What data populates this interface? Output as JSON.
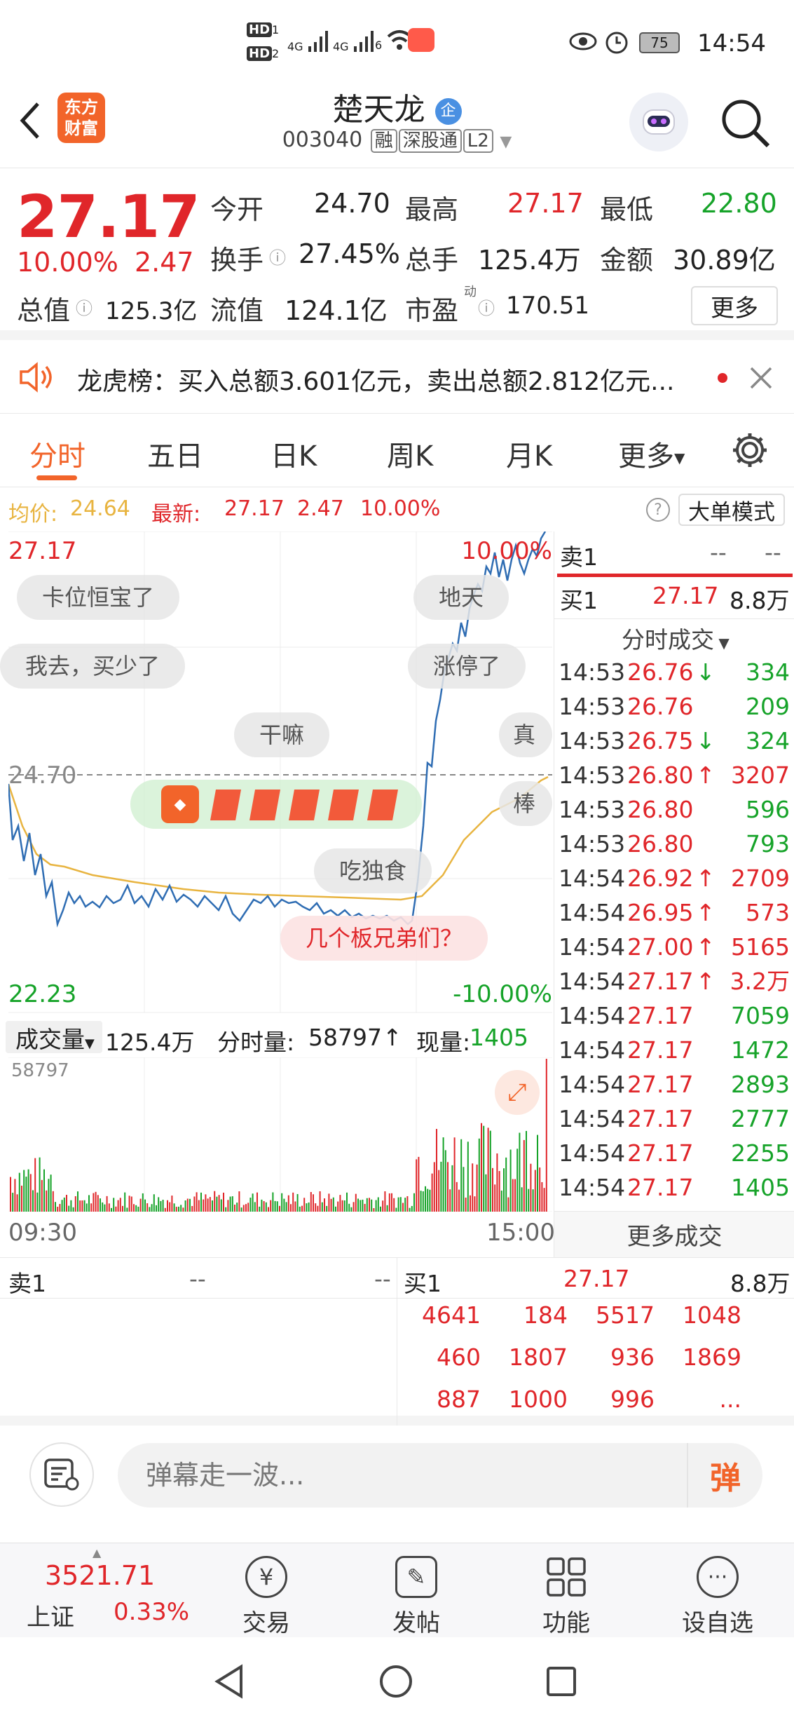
{
  "status_bar": {
    "hd1": "HD",
    "hd1_sub": "1",
    "hd2": "HD",
    "hd2_sub": "2",
    "net1": "4G",
    "net2": "4G",
    "wifi_sub": "6",
    "battery": "75",
    "time": "14:54"
  },
  "header": {
    "logo_line1": "东方",
    "logo_line2": "财富",
    "stock_name": "楚天龙",
    "badge": "企",
    "stock_code": "003040",
    "tags": [
      "融",
      "深股通",
      "L2"
    ]
  },
  "quote": {
    "price": "27.17",
    "change_pct": "10.00%",
    "change_amt": "2.47",
    "open_label": "今开",
    "open": "24.70",
    "high_label": "最高",
    "high": "27.17",
    "low_label": "最低",
    "low": "22.80",
    "turnover_label": "换手",
    "turnover": "27.45%",
    "volume_label": "总手",
    "volume": "125.4万",
    "amount_label": "金额",
    "amount": "30.89亿",
    "mktcap_label": "总值",
    "mktcap": "125.3亿",
    "float_label": "流值",
    "float": "124.1亿",
    "pe_label": "市盈",
    "pe_sup": "动",
    "pe": "170.51",
    "more_button": "更多"
  },
  "notice": {
    "text": "龙虎榜：买入总额3.601亿元，卖出总额2.812亿元..."
  },
  "tabs": {
    "items": [
      "分时",
      "五日",
      "日K",
      "周K",
      "月K",
      "更多"
    ]
  },
  "infoline": {
    "avg_label": "均价:",
    "avg": "24.64",
    "latest_label": "最新:",
    "latest": "27.17",
    "latest_chg": "2.47",
    "latest_pct": "10.00%",
    "mode_button": "大单模式"
  },
  "chart_labels": {
    "top_price": "27.17",
    "top_pct": "10.00%",
    "mid_price": "24.70",
    "bottom_price": "22.23",
    "bottom_pct": "-10.00%"
  },
  "danmaku": [
    "卡位恒宝了",
    "地天",
    "我去，买少了",
    "涨停了",
    "干嘛",
    "真",
    "棒",
    "吃独食",
    "几个板兄弟们？"
  ],
  "volume": {
    "label": "成交量",
    "total": "125.4万",
    "minute_label": "分时量:",
    "minute": "58797",
    "current_label": "现量:",
    "current": "1405",
    "max_label": "58797",
    "time_start": "09:30",
    "time_end": "15:00"
  },
  "panel": {
    "sell1_label": "卖1",
    "sell1_price": "--",
    "sell1_vol": "--",
    "buy1_label": "买1",
    "buy1_price": "27.17",
    "buy1_vol": "8.8万",
    "ticks_title": "分时成交",
    "ticks": [
      {
        "t": "14:53",
        "p": "26.76",
        "arrow": "↓",
        "v": "334",
        "pc": "red",
        "vc": "green"
      },
      {
        "t": "14:53",
        "p": "26.76",
        "arrow": "",
        "v": "209",
        "pc": "red",
        "vc": "green"
      },
      {
        "t": "14:53",
        "p": "26.75",
        "arrow": "↓",
        "v": "324",
        "pc": "red",
        "vc": "green"
      },
      {
        "t": "14:53",
        "p": "26.80",
        "arrow": "↑",
        "v": "3207",
        "pc": "red",
        "vc": "red"
      },
      {
        "t": "14:53",
        "p": "26.80",
        "arrow": "",
        "v": "596",
        "pc": "red",
        "vc": "green"
      },
      {
        "t": "14:53",
        "p": "26.80",
        "arrow": "",
        "v": "793",
        "pc": "red",
        "vc": "green"
      },
      {
        "t": "14:54",
        "p": "26.92",
        "arrow": "↑",
        "v": "2709",
        "pc": "red",
        "vc": "red"
      },
      {
        "t": "14:54",
        "p": "26.95",
        "arrow": "↑",
        "v": "573",
        "pc": "red",
        "vc": "red"
      },
      {
        "t": "14:54",
        "p": "27.00",
        "arrow": "↑",
        "v": "5165",
        "pc": "red",
        "vc": "red"
      },
      {
        "t": "14:54",
        "p": "27.17",
        "arrow": "↑",
        "v": "3.2万",
        "pc": "red",
        "vc": "red"
      },
      {
        "t": "14:54",
        "p": "27.17",
        "arrow": "",
        "v": "7059",
        "pc": "red",
        "vc": "green"
      },
      {
        "t": "14:54",
        "p": "27.17",
        "arrow": "",
        "v": "1472",
        "pc": "red",
        "vc": "green"
      },
      {
        "t": "14:54",
        "p": "27.17",
        "arrow": "",
        "v": "2893",
        "pc": "red",
        "vc": "green"
      },
      {
        "t": "14:54",
        "p": "27.17",
        "arrow": "",
        "v": "2777",
        "pc": "red",
        "vc": "green"
      },
      {
        "t": "14:54",
        "p": "27.17",
        "arrow": "",
        "v": "2255",
        "pc": "red",
        "vc": "green"
      },
      {
        "t": "14:54",
        "p": "27.17",
        "arrow": "",
        "v": "1405",
        "pc": "red",
        "vc": "green"
      }
    ],
    "more_ticks": "更多成交"
  },
  "book": {
    "sell_label": "卖1",
    "sell_price": "--",
    "sell_vol": "--",
    "buy_label": "买1",
    "buy_price": "27.17",
    "buy_vol": "8.8万",
    "queue": [
      [
        "4641",
        "184",
        "5517",
        "1048"
      ],
      [
        "460",
        "1807",
        "936",
        "1869"
      ],
      [
        "887",
        "1000",
        "996",
        "..."
      ]
    ]
  },
  "comment": {
    "placeholder": "弹幕走一波...",
    "danmu_button": "弹"
  },
  "bottom_nav": {
    "index_value": "3521.71",
    "index_name": "上证",
    "index_pct": "0.33%",
    "items": [
      "交易",
      "发帖",
      "功能",
      "设自选"
    ]
  },
  "colors": {
    "up": "#e0262a",
    "down": "#16a329",
    "accent": "#f2642a",
    "avg_line": "#e8b440",
    "price_line": "#2f6db3"
  }
}
